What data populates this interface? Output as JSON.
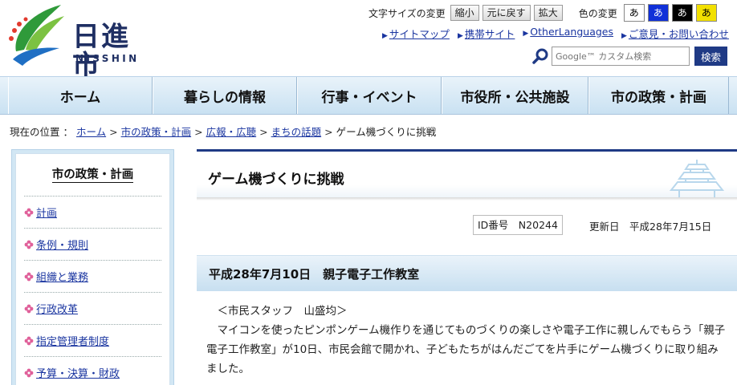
{
  "header": {
    "logo_name": "日進市",
    "logo_roman": "NISSHIN",
    "text_size_label": "文字サイズの変更",
    "text_size_buttons": [
      "縮小",
      "元に戻す",
      "拡大"
    ],
    "color_label": "色の変更",
    "color_buttons": [
      {
        "label": "あ",
        "bg": "#ffffff",
        "fg": "#000000"
      },
      {
        "label": "あ",
        "bg": "#1030d8",
        "fg": "#ffffff"
      },
      {
        "label": "あ",
        "bg": "#000000",
        "fg": "#ffffff"
      },
      {
        "label": "あ",
        "bg": "#f2e000",
        "fg": "#000000"
      }
    ],
    "links": [
      "サイトマップ",
      "携帯サイト",
      "OtherLanguages",
      "ご意見・お問い合わせ"
    ],
    "search_placeholder": "Google™ カスタム検索",
    "search_button": "検索"
  },
  "nav": {
    "items": [
      "ホーム",
      "暮らしの情報",
      "行事・イベント",
      "市役所・公共施設",
      "市の政策・計画"
    ]
  },
  "breadcrumb": {
    "prefix": "現在の位置 ：",
    "links": [
      "ホーム",
      "市の政策・計画",
      "広報・広聴",
      "まちの話題"
    ],
    "current": "ゲーム機づくりに挑戦"
  },
  "sidebar": {
    "title": "市の政策・計画",
    "items": [
      "計画",
      "条例・規則",
      "組織と業務",
      "行政改革",
      "指定管理者制度",
      "予算・決算・財政"
    ]
  },
  "main": {
    "title": "ゲーム機づくりに挑戦",
    "id_label": "ID番号　N20244",
    "updated": "更新日　平成28年7月15日",
    "section_heading": "平成28年7月10日　親子電子工作教室",
    "staff_line": "＜市民スタッフ　山盛均＞",
    "paragraph": "マイコンを使ったピンポンゲーム機作りを通じてものづくりの楽しさや電子工作に親しんでもらう「親子電子工作教室」が10日、市民会館で開かれ、子どもたちがはんだごてを片手にゲーム機づくりに取り組みました。"
  },
  "colors": {
    "brand_navy": "#1f3a85",
    "link": "#1a35a0",
    "nav_bg": "#c9e1f2"
  }
}
